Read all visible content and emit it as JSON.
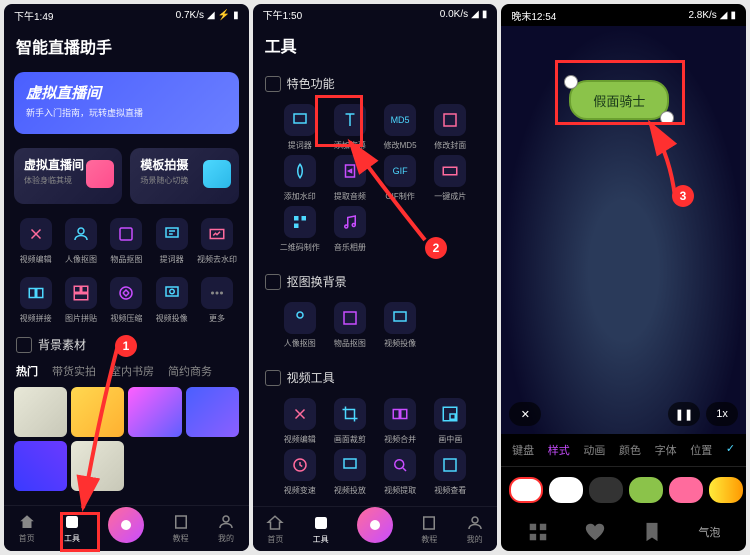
{
  "p1": {
    "time": "下午1:49",
    "net": "0.7K/s",
    "title": "智能直播助手",
    "banner": {
      "title": "虚拟直播间",
      "sub": "新手入门指南，玩转虚拟直播"
    },
    "cards": [
      {
        "title": "虚拟直播间",
        "sub": "体验身临其境"
      },
      {
        "title": "模板拍摄",
        "sub": "场景随心切换"
      }
    ],
    "tools1": [
      "视频编辑",
      "人像抠图",
      "物品抠图",
      "提词器",
      "视频去水印"
    ],
    "tools2": [
      "视频拼接",
      "图片拼贴",
      "视频压缩",
      "视频投像",
      "更多"
    ],
    "sec": "背景素材",
    "tabs": [
      "热门",
      "带货实拍",
      "室内书房",
      "简约商务"
    ],
    "nav": [
      "首页",
      "工具",
      "",
      "教程",
      "我的"
    ]
  },
  "p2": {
    "time": "下午1:50",
    "net": "0.0K/s",
    "title": "工具",
    "sec1": "特色功能",
    "g1": [
      "提词器",
      "添加字幕",
      "修改MD5",
      "修改封面",
      "添加水印",
      "提取音频",
      "GIF制作",
      "一键成片",
      "二维码制作",
      "音乐相册"
    ],
    "sec2": "抠图换背景",
    "g2": [
      "人像抠图",
      "物品抠图",
      "视频投像"
    ],
    "sec3": "视频工具",
    "g3": [
      "视频编辑",
      "画面裁剪",
      "视频合并",
      "画中画",
      "视频变速",
      "视频投放",
      "视频提取",
      "视频查看"
    ],
    "nav": [
      "首页",
      "工具",
      "",
      "教程",
      "我的"
    ]
  },
  "p3": {
    "time": "晚末12:54",
    "net": "2.8K/s",
    "bubble": "假面骑士",
    "speed": "1x",
    "tabs": [
      "键盘",
      "样式",
      "动画",
      "颜色",
      "字体",
      "位置"
    ],
    "qipao": "气泡"
  },
  "badges": {
    "b1": "1",
    "b2": "2",
    "b3": "3"
  }
}
